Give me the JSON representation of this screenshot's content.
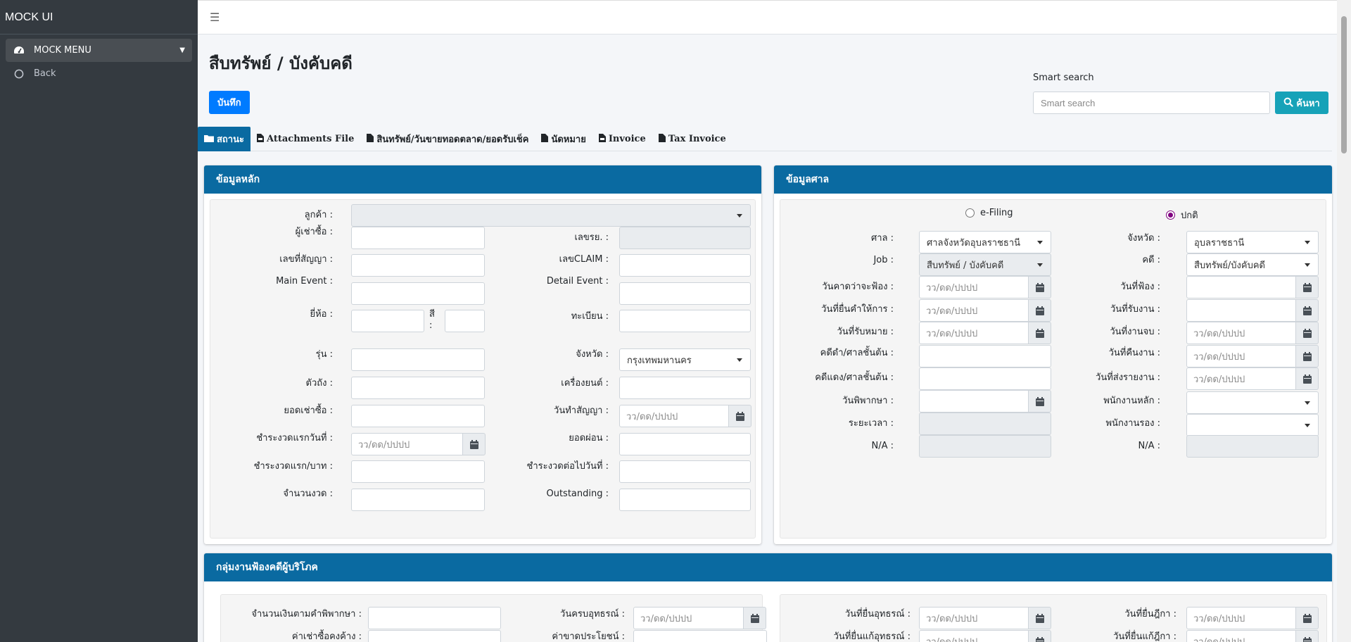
{
  "brand": "MOCK UI",
  "sidebar": {
    "items": [
      {
        "label": "MOCK MENU",
        "icon": "gauge-icon"
      },
      {
        "label": "Back",
        "icon": "circle-icon"
      }
    ]
  },
  "page": {
    "title": "สืบทรัพย์ / บังคับคดี",
    "save_label": "บันทึก",
    "smart_label": "Smart search",
    "smart_placeholder": "Smart search",
    "search_label": "ค้นหา"
  },
  "tabs": [
    {
      "label": "สถานะ",
      "icon": "folder-icon"
    },
    {
      "label": "Attachments File",
      "icon": "file-pdf-icon"
    },
    {
      "label": "สินทรัพย์/วันขายทอดตลาด/ยอดรับเช็ค",
      "icon": "file-icon"
    },
    {
      "label": "นัดหมาย",
      "icon": "file-icon"
    },
    {
      "label": "Invoice",
      "icon": "file-pdf-icon"
    },
    {
      "label": "Tax Invoice",
      "icon": "file-icon"
    }
  ],
  "main_card": {
    "title": "ข้อมูลหลัก",
    "customer_label": "ลูกค้า :",
    "renter_label": "ผู้เช่าซื้อ :",
    "reg_no_label": "เลขรย. :",
    "contract_label": "เลขที่สัญญา :",
    "claim_label": "เลขCLAIM :",
    "main_event_label": "Main Event :",
    "detail_event_label": "Detail Event :",
    "brand_label": "ยี่ห้อ :",
    "color_label": "สี :",
    "plate_label": "ทะเบียน :",
    "model_label": "รุ่น :",
    "province_label": "จังหวัด :",
    "province_value": "กรุงเทพมหานคร",
    "body_label": "ตัวถัง :",
    "engine_label": "เครื่องยนต์ :",
    "hire_total_label": "ยอดเช่าซื้อ :",
    "contract_date_label": "วันทำสัญญา :",
    "first_pay_date_label": "ชำระงวดแรกวันที่ :",
    "installment_label": "ยอดผ่อน :",
    "first_pay_amount_label": "ชำระงวดแรก/บาท :",
    "next_pay_date_label": "ชำระงวดต่อไปวันที่ :",
    "periods_label": "จำนวนงวด :",
    "outstanding_label": "Outstanding :",
    "date_placeholder": "วว/ดด/ปปปป"
  },
  "court_card": {
    "title": "ข้อมูลศาล",
    "efiling_label": "e-Filing",
    "normal_label": "ปกติ",
    "court_label": "ศาล :",
    "court_value": "ศาลจังหวัดอุบลราชธานี",
    "province_label": "จังหวัด :",
    "province_value": "อุบลราชธานี",
    "job_label": "Job :",
    "job_value": "สืบทรัพย์ / บังคับคดี",
    "case_label": "คดี :",
    "case_value": "สืบทรัพย์/บังคับคดี",
    "expected_sue_label": "วันคาดว่าจะฟ้อง :",
    "sue_date_label": "วันที่ฟ้อง :",
    "testimony_date_label": "วันที่ยื่นคำให้การ :",
    "accept_date_label": "วันที่รับงาน :",
    "summons_date_label": "วันที่รับหมาย :",
    "job_end_label": "วันที่งานจบ :",
    "black_case_label": "คดีดำ/ศาลชั้นต้น :",
    "return_date_label": "วันที่คืนงาน :",
    "red_case_label": "คดีแดง/ศาลชั้นต้น :",
    "report_date_label": "วันที่ส่งรายงาน :",
    "judgment_date_label": "วันพิพากษา :",
    "main_staff_label": "พนักงานหลัก :",
    "duration_label": "ระยะเวลา :",
    "sub_staff_label": "พนักงานรอง :",
    "na_left_label": "N/A :",
    "na_right_label": "N/A :",
    "date_placeholder": "วว/ดด/ปปปป"
  },
  "consumer_card": {
    "title": "กลุ่มงานฟ้องคดีผู้บริโภค",
    "judgment_amount_label": "จำนวนเงินตามคำพิพากษา :",
    "appeal_due_label": "วันครบอุทธรณ์ :",
    "overdue_rent_label": "ค่าเช่าซื้อคงค้าง :",
    "loss_benefit_label": "ค่าขาดประโยชน์ :",
    "appeal_file_label": "วันที่ยื่นอุทธรณ์ :",
    "supreme_file_label": "วันที่ยื่นฎีกา :",
    "appeal_amend_label": "วันที่ยื่นแก้อุทธรณ์ :",
    "supreme_amend_label": "วันที่ยื่นแก้ฎีกา :",
    "date_placeholder": "วว/ดด/ปปปป"
  }
}
